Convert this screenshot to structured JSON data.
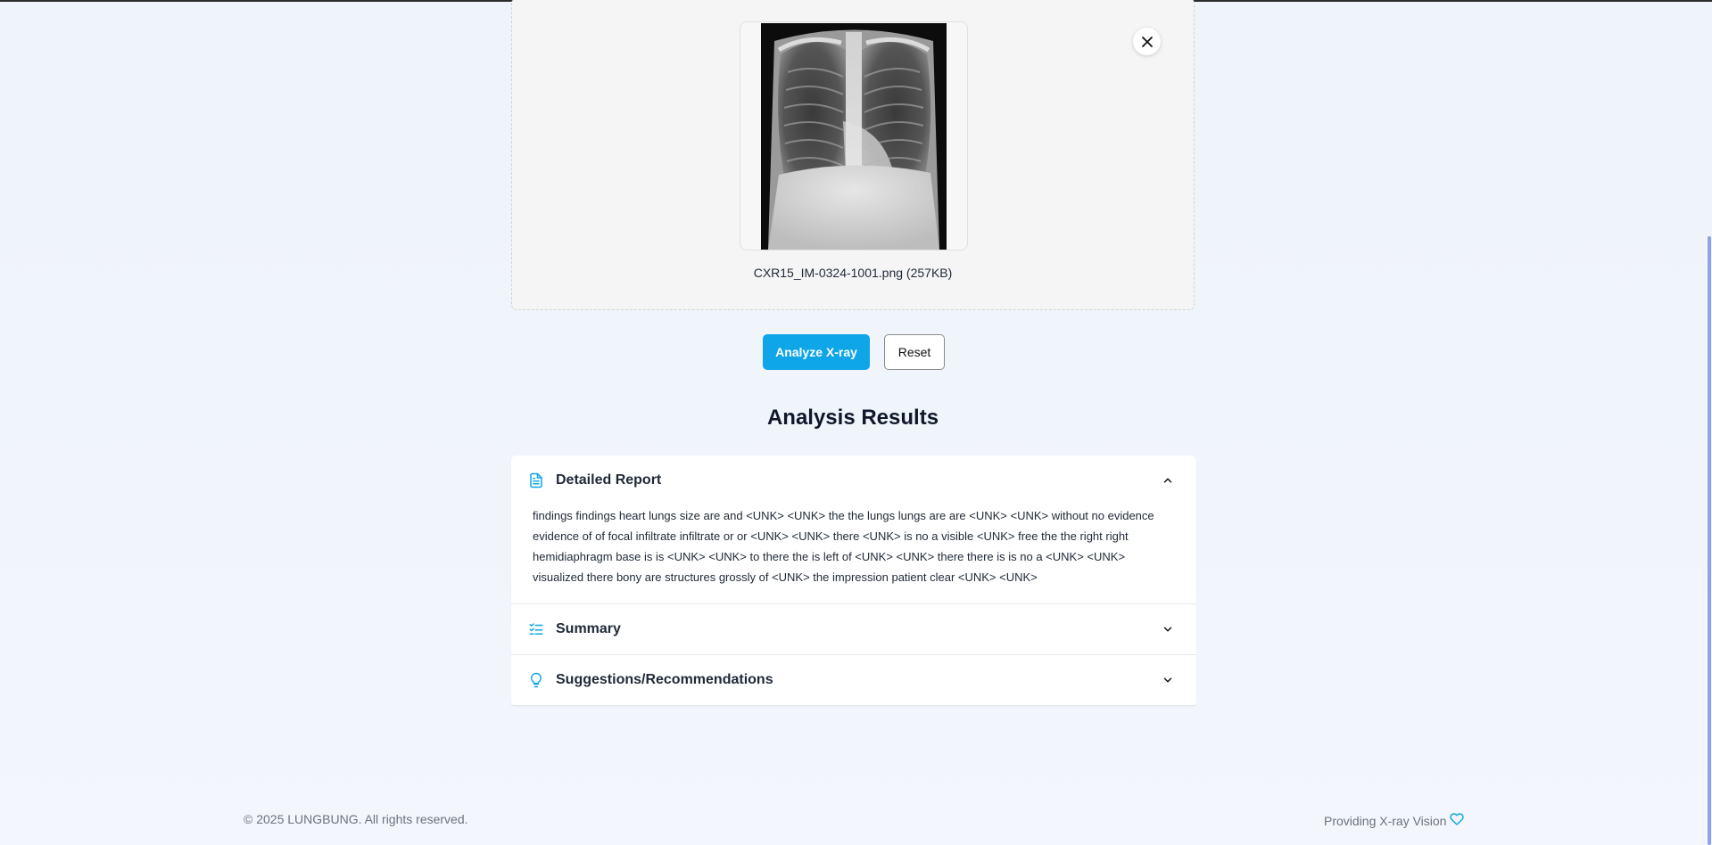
{
  "upload": {
    "filename": "CXR15_IM-0324-1001.png",
    "filesize": "(257KB)",
    "filename_display": "CXR15_IM-0324-1001.png (257KB)"
  },
  "actions": {
    "analyze_label": "Analyze X-ray",
    "reset_label": "Reset"
  },
  "results": {
    "title": "Analysis Results",
    "sections": [
      {
        "title": "Detailed Report",
        "icon": "document-icon",
        "expanded": true,
        "body": "findings findings heart lungs size are and <UNK> <UNK> the the lungs lungs are are <UNK> <UNK> without no evidence evidence of of focal infiltrate infiltrate or or <UNK> <UNK> there <UNK> is no a visible <UNK> free the the right right hemidiaphragm base is is <UNK> <UNK> to there the is left of <UNK> <UNK> there there is is no a <UNK> <UNK> visualized there bony are structures grossly of <UNK> the impression patient clear <UNK> <UNK>"
      },
      {
        "title": "Summary",
        "icon": "checklist-icon",
        "expanded": false
      },
      {
        "title": "Suggestions/Recommendations",
        "icon": "lightbulb-icon",
        "expanded": false
      }
    ]
  },
  "footer": {
    "copyright": "© 2025 LUNGBUNG. All rights reserved.",
    "tagline": "Providing X-ray Vision",
    "tagline_icon": "heart-icon"
  },
  "colors": {
    "accent": "#0ea5e9",
    "page_bg": "#eef4fa",
    "scrollbar": "#8ea2ea"
  }
}
